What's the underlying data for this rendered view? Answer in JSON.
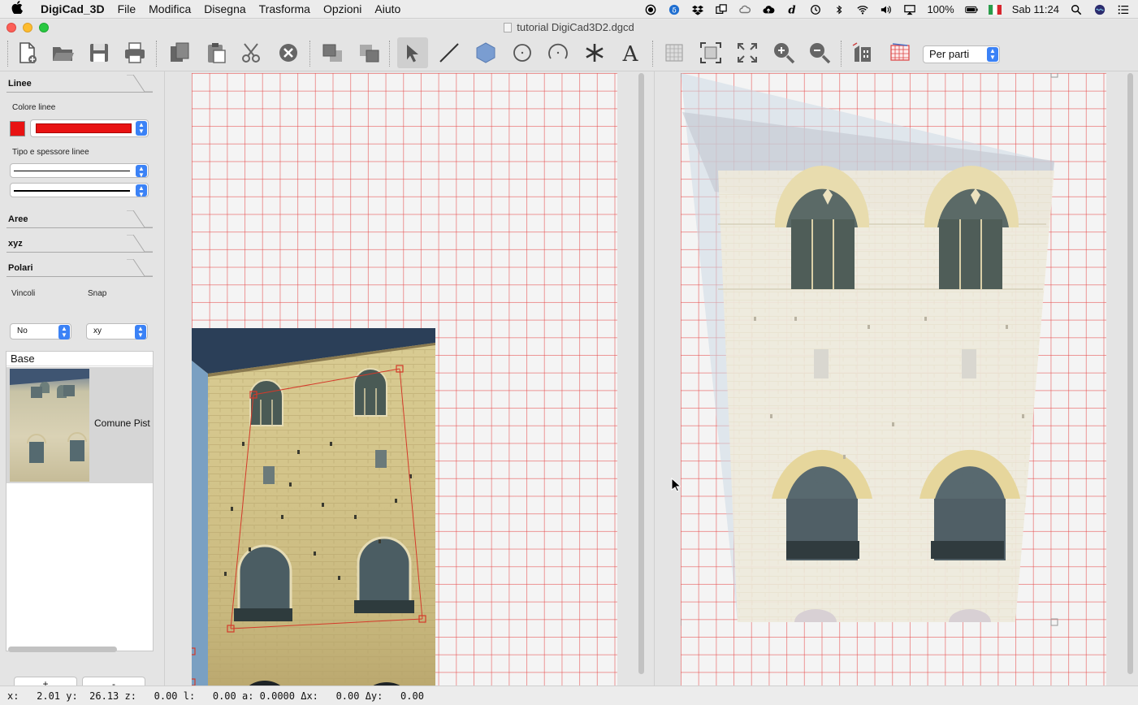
{
  "menubar": {
    "app_name": "DigiCad_3D",
    "items": [
      "File",
      "Modifica",
      "Disegna",
      "Trasforma",
      "Opzioni",
      "Aiuto"
    ],
    "battery": "100%",
    "clock": "Sab 11:24"
  },
  "window": {
    "title": "tutorial DigiCad3D2.dgcd",
    "mode_select": "Per parti"
  },
  "left_panel": {
    "sections": {
      "lines": "Linee",
      "areas": "Aree",
      "xyz": "xyz",
      "polar": "Polari"
    },
    "line_color_label": "Colore linee",
    "line_color": "#e81212",
    "line_type_label": "Tipo e spessore linee",
    "constraints_label": "Vincoli",
    "constraints_value": "No",
    "snap_label": "Snap",
    "snap_value": "xy",
    "layer_header": "Base",
    "layer_name": "Comune Pist",
    "add_button": "+",
    "remove_button": "-"
  },
  "statusbar": {
    "text": "x:   2.01 y:  26.13 z:   0.00 l:   0.00 a: 0.0000 Δx:   0.00 Δy:   0.00"
  }
}
